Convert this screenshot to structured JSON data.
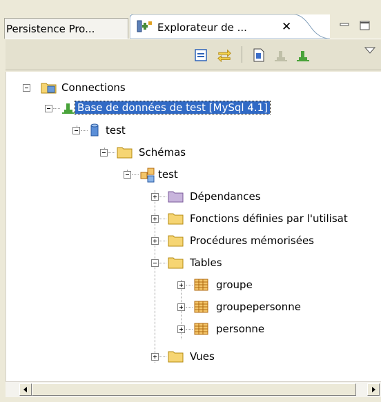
{
  "tabs": [
    {
      "label": "Persistence Pro..."
    },
    {
      "label": "Explorateur de ...",
      "active": true
    }
  ],
  "tab_close_glyph": "✕",
  "colors": {
    "selection": "#316ac5",
    "folder": "#f6d573",
    "folder_purple": "#c8b4dc",
    "table": "#f3c56a"
  },
  "toolbar": {
    "buttons": [
      "collapse-all-icon",
      "link-with-editor-icon",
      "new-sql-page-icon",
      "disconnect-icon",
      "connect-icon",
      "view-menu-icon"
    ]
  },
  "tree": {
    "root": "Connections",
    "connection": "Base de données de test [MySql 4.1]",
    "database": "test",
    "schemas": "Schémas",
    "schema": "test",
    "dependances": "Dépendances",
    "functions": "Fonctions définies par l'utilisat",
    "procedures": "Procédures mémorisées",
    "tables": "Tables",
    "table_items": [
      "groupe",
      "groupepersonne",
      "personne"
    ],
    "views": "Vues"
  }
}
